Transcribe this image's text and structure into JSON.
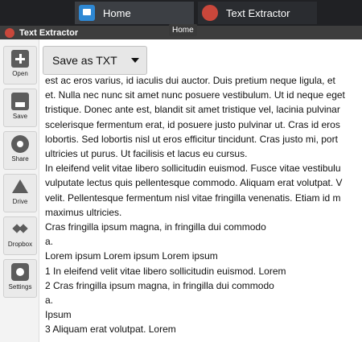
{
  "taskbar": {
    "tabs": [
      {
        "label": "Home",
        "icon": "home-icon"
      },
      {
        "label": "Text Extractor",
        "icon": "text-extractor-app-icon"
      }
    ],
    "tooltip": "Home"
  },
  "app": {
    "title": "Text Extractor",
    "icon": "text-extractor-app-icon"
  },
  "sidebar": {
    "items": [
      {
        "label": "Open",
        "icon": "open-icon"
      },
      {
        "label": "Save",
        "icon": "save-icon"
      },
      {
        "label": "Share",
        "icon": "share-icon"
      },
      {
        "label": "Drive",
        "icon": "drive-icon"
      },
      {
        "label": "Dropbox",
        "icon": "dropbox-icon"
      },
      {
        "label": "Settings",
        "icon": "settings-icon"
      }
    ]
  },
  "toolbar": {
    "save_format": "Save as TXT"
  },
  "document": {
    "lines": [
      "est ac eros varius, id iaculis dui auctor. Duis pretium neque ligula, et",
      "et. Nulla nec nunc sit amet nunc posuere vestibulum. Ut id neque eget",
      "tristique. Donec ante est, blandit sit amet tristique vel, lacinia pulvinar",
      "scelerisque fermentum erat, id posuere justo pulvinar ut. Cras id eros",
      "lobortis. Sed lobortis nisl ut eros efficitur tincidunt. Cras justo mi, port",
      "ultricies ut purus. Ut facilisis et lacus eu cursus.",
      "In eleifend velit vitae libero sollicitudin euismod. Fusce vitae vestibulu",
      "vulputate lectus quis pellentesque commodo. Aliquam erat volutpat. V",
      "velit. Pellentesque fermentum nisl vitae fringilla venenatis. Etiam id m",
      "maximus ultricies.",
      "Cras fringilla ipsum magna, in fringilla dui commodo",
      "a.",
      "Lorem ipsum Lorem ipsum Lorem ipsum",
      "1 In eleifend velit vitae libero sollicitudin euismod. Lorem",
      "2 Cras fringilla ipsum magna, in fringilla dui commodo",
      "a.",
      "Ipsum",
      "3 Aliquam erat volutpat. Lorem"
    ]
  }
}
